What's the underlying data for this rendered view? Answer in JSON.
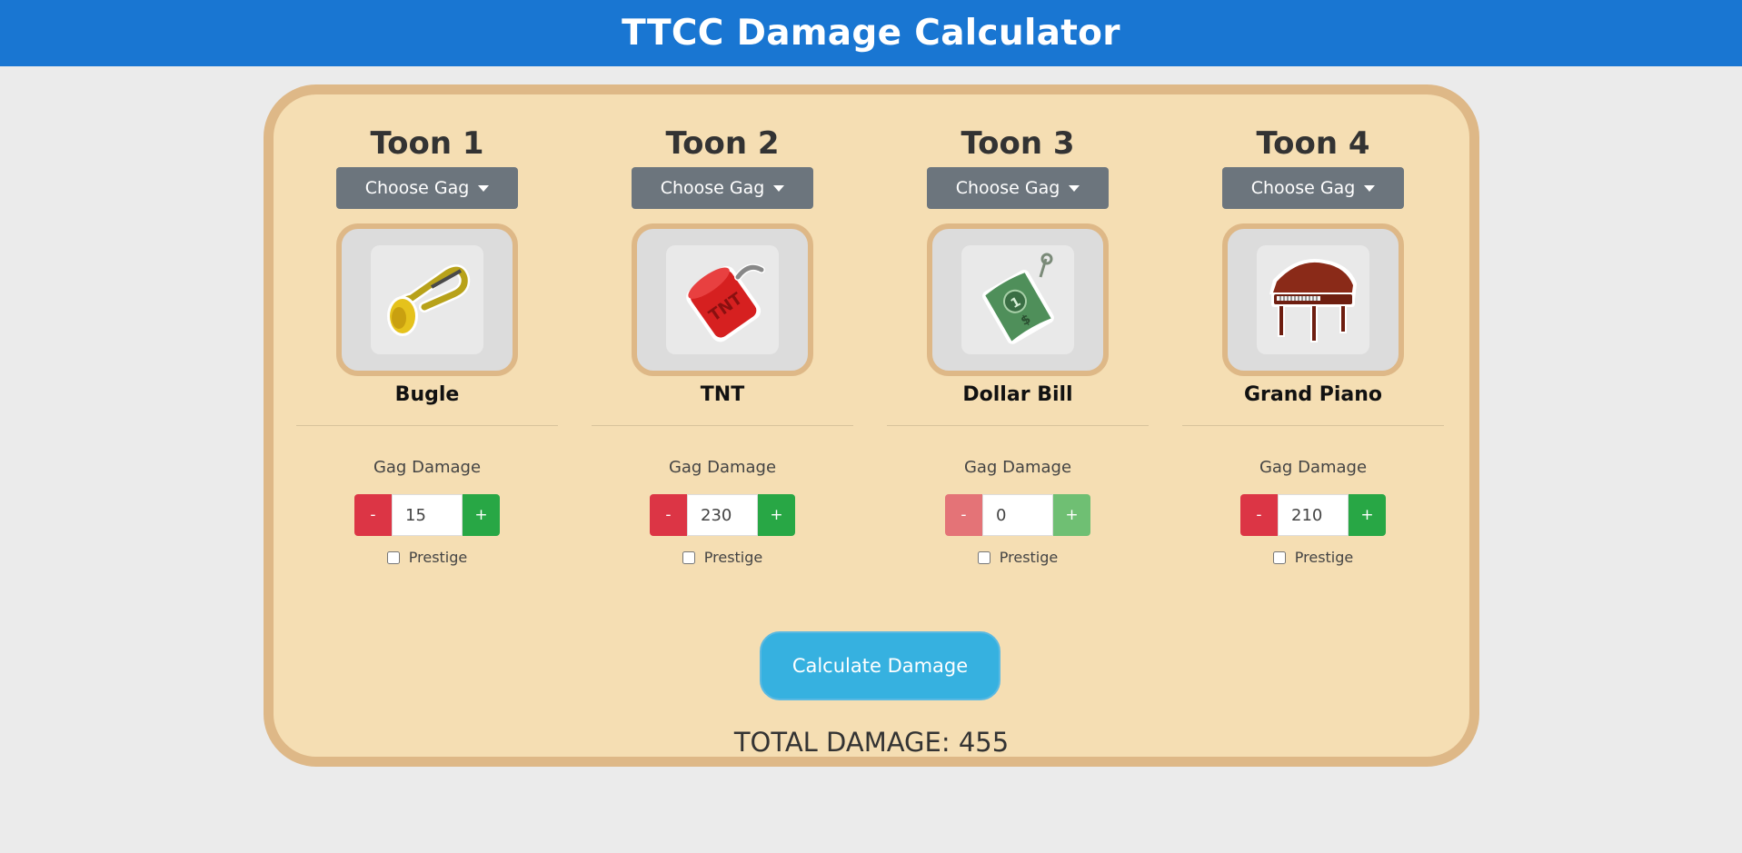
{
  "header": {
    "title": "TTCC Damage Calculator"
  },
  "toons": [
    {
      "title": "Toon 1",
      "choose_label": "Choose Gag",
      "gag_name": "Bugle",
      "gag_icon": "bugle-icon",
      "damage_label": "Gag Damage",
      "damage_value": "15",
      "minus": "-",
      "plus": "+",
      "prestige_label": "Prestige",
      "prestige_checked": false,
      "disabled": false
    },
    {
      "title": "Toon 2",
      "choose_label": "Choose Gag",
      "gag_name": "TNT",
      "gag_icon": "tnt-icon",
      "damage_label": "Gag Damage",
      "damage_value": "230",
      "minus": "-",
      "plus": "+",
      "prestige_label": "Prestige",
      "prestige_checked": false,
      "disabled": false
    },
    {
      "title": "Toon 3",
      "choose_label": "Choose Gag",
      "gag_name": "Dollar Bill",
      "gag_icon": "dollar-bill-icon",
      "damage_label": "Gag Damage",
      "damage_value": "0",
      "minus": "-",
      "plus": "+",
      "prestige_label": "Prestige",
      "prestige_checked": false,
      "disabled": true
    },
    {
      "title": "Toon 4",
      "choose_label": "Choose Gag",
      "gag_name": "Grand Piano",
      "gag_icon": "grand-piano-icon",
      "damage_label": "Gag Damage",
      "damage_value": "210",
      "minus": "-",
      "plus": "+",
      "prestige_label": "Prestige",
      "prestige_checked": false,
      "disabled": false
    }
  ],
  "calculate_label": "Calculate Damage",
  "total_label": "TOTAL DAMAGE: 455",
  "colors": {
    "header_bg": "#1976d2",
    "panel_bg": "#f5deb3",
    "panel_border": "#deb887",
    "minus_btn": "#dc3545",
    "plus_btn": "#28a745",
    "choose_btn": "#6c757d",
    "calculate_btn": "#36b1e0"
  }
}
